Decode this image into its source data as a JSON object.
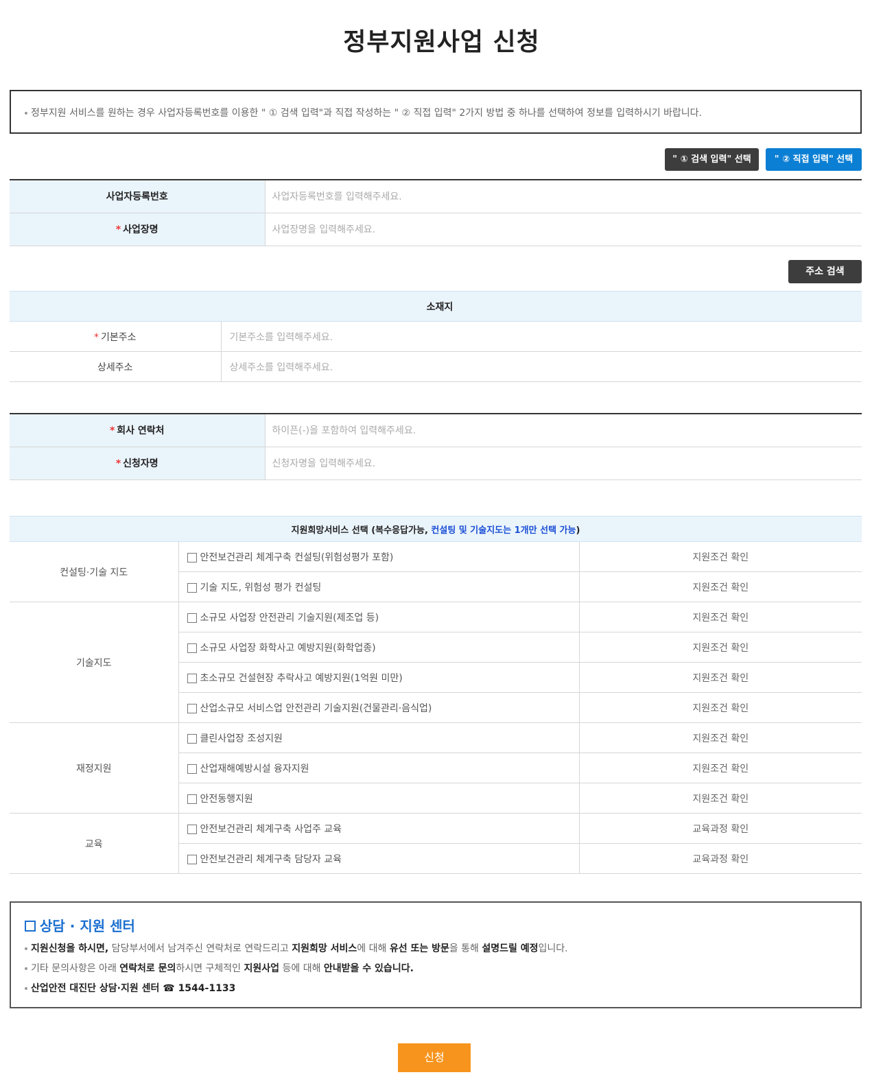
{
  "page": {
    "title": "정부지원사업 신청"
  },
  "notice": {
    "text": "정부지원 서비스를 원하는 경우 사업자등록번호를 이용한 \" ① 검색 입력\"과 직접 작성하는 \" ② 직접 입력\" 2가지 방법 중 하나를 선택하여 정보를 입력하시기 바랍니다."
  },
  "mode_buttons": {
    "search": "\" ① 검색 입력\" 선택",
    "direct": "\" ② 직접 입력\" 선택"
  },
  "business": {
    "reg_no": {
      "label": "사업자등록번호",
      "placeholder": "사업자등록번호를 입력해주세요."
    },
    "name": {
      "star": "*",
      "label": "사업장명",
      "placeholder": "사업장명을 입력해주세요."
    }
  },
  "address": {
    "search_button": "주소 검색",
    "section_title": "소재지",
    "basic": {
      "star": "*",
      "label": "기본주소",
      "placeholder": "기본주소를 입력해주세요."
    },
    "detail": {
      "label": "상세주소",
      "placeholder": "상세주소를 입력해주세요."
    }
  },
  "contact": {
    "phone": {
      "star": "*",
      "label": "회사 연락처",
      "placeholder": "하이픈(-)을 포함하여 입력해주세요."
    },
    "applicant": {
      "star": "*",
      "label": "신청자명",
      "placeholder": "신청자명을 입력해주세요."
    }
  },
  "services": {
    "title_a": "지원희망서비스 선택 (복수응답가능, ",
    "title_b": "컨설팅 및 기술지도는 1개만 선택 가능",
    "title_c": ")",
    "groups": [
      {
        "category": "컨설팅·기술 지도",
        "items": [
          {
            "label": "안전보건관리 체계구축 컨설팅(위험성평가 포함)",
            "link": "지원조건 확인"
          },
          {
            "label": "기술 지도, 위험성 평가 컨설팅",
            "link": "지원조건 확인"
          }
        ]
      },
      {
        "category": "기술지도",
        "items": [
          {
            "label": "소규모 사업장 안전관리 기술지원(제조업 등)",
            "link": "지원조건 확인"
          },
          {
            "label": "소규모 사업장 화학사고 예방지원(화학업종)",
            "link": "지원조건 확인"
          },
          {
            "label": "초소규모 건설현장 추락사고 예방지원(1억원 미만)",
            "link": "지원조건 확인"
          },
          {
            "label": "산업소규모 서비스업 안전관리 기술지원(건물관리·음식업)",
            "link": "지원조건 확인"
          }
        ]
      },
      {
        "category": "재정지원",
        "items": [
          {
            "label": "클린사업장 조성지원",
            "link": "지원조건 확인"
          },
          {
            "label": "산업재해예방시설 융자지원",
            "link": "지원조건 확인"
          },
          {
            "label": "안전동행지원",
            "link": "지원조건 확인"
          }
        ]
      },
      {
        "category": "교육",
        "items": [
          {
            "label": "안전보건관리 체계구축 사업주 교육",
            "link": "교육과정 확인"
          },
          {
            "label": "안전보건관리 체계구축 담당자 교육",
            "link": "교육과정 확인"
          }
        ]
      }
    ]
  },
  "help": {
    "title": "상담 · 지원 센터",
    "line1": [
      {
        "t": "지원신청을 하시면,",
        "b": true
      },
      {
        "t": " 담당부서에서 남겨주신 연락처로 연락드리고 ",
        "b": false
      },
      {
        "t": "지원희망 서비스",
        "b": true
      },
      {
        "t": "에 대해 ",
        "b": false
      },
      {
        "t": "유선 또는 방문",
        "b": true
      },
      {
        "t": "을 통해 ",
        "b": false
      },
      {
        "t": "설명드릴 예정",
        "b": true
      },
      {
        "t": "입니다.",
        "b": false
      }
    ],
    "line2": [
      {
        "t": "기타 문의사항은 아래 ",
        "b": false
      },
      {
        "t": "연락처로 문의",
        "b": true
      },
      {
        "t": "하시면 구체적인 ",
        "b": false
      },
      {
        "t": "지원사업",
        "b": true
      },
      {
        "t": " 등에 대해 ",
        "b": false
      },
      {
        "t": "안내받을 수 있습니다.",
        "b": true
      }
    ],
    "line3": [
      {
        "t": "산업안전 대진단 상담·지원 센터 ☎ 1544-1133",
        "b": true
      }
    ]
  },
  "submit": "신청",
  "colors": {
    "accent_blue": "#0b7fd4",
    "submit_orange": "#f7941d",
    "header_bg": "#eaf4fb"
  }
}
